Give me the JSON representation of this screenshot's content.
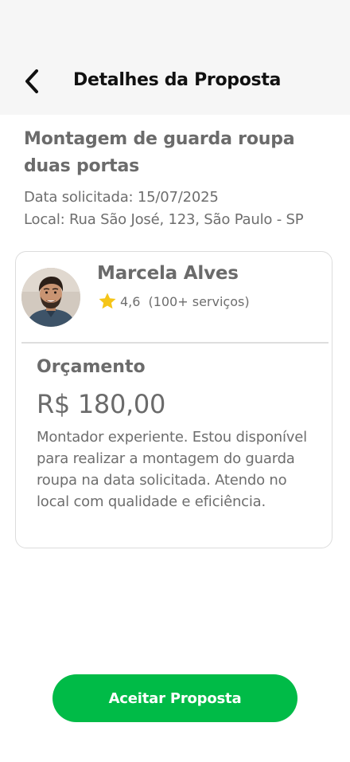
{
  "header": {
    "title": "Detalhes da Proposta",
    "back_icon": "chevron-left-icon"
  },
  "job": {
    "title": "Montagem de guarda roupa duas portas",
    "date_line": "Data solicitada: 15/07/2025",
    "location_line": "Local: Rua São José, 123, São Paulo - SP"
  },
  "proposal": {
    "provider_name": "Marcela Alves",
    "rating": "4,6",
    "services_count": "(100+ serviços)",
    "star_icon": "star-icon",
    "star_color": "#f5c518",
    "budget_label": "Orçamento",
    "price": "R$ 180,00",
    "description": "Montador experiente. Estou disponível para realizar a montagem do guarda roupa na data solicitada. Atendo no local com qualidade e eficiência."
  },
  "actions": {
    "accept_label": "Aceitar Proposta",
    "accept_color": "#00bb47"
  }
}
